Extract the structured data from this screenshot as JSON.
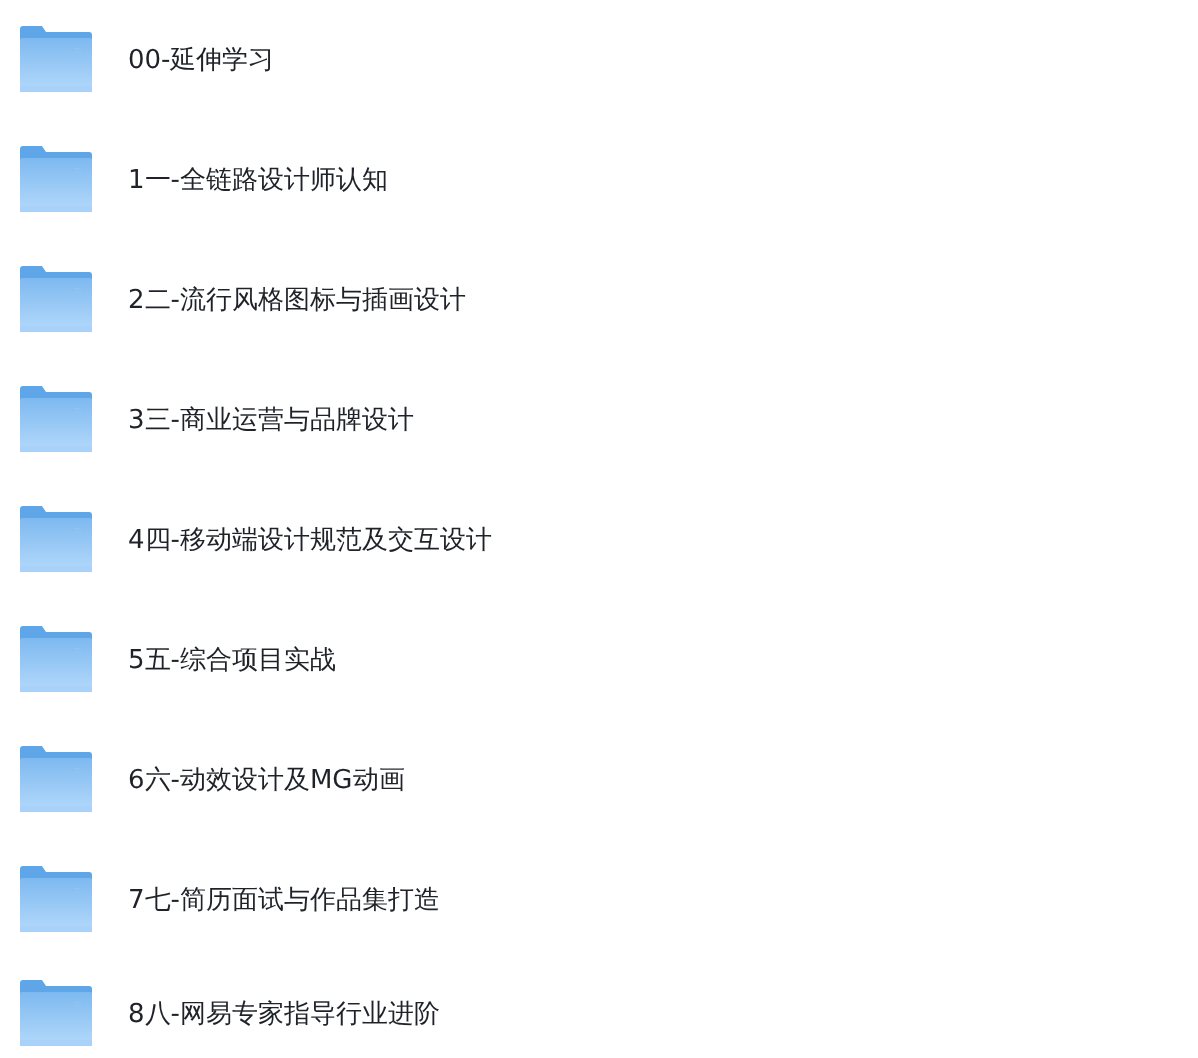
{
  "folders": [
    {
      "name": "00-延伸学习"
    },
    {
      "name": "1一-全链路设计师认知"
    },
    {
      "name": "2二-流行风格图标与插画设计"
    },
    {
      "name": "3三-商业运营与品牌设计"
    },
    {
      "name": "4四-移动端设计规范及交互设计"
    },
    {
      "name": "5五-综合项目实战"
    },
    {
      "name": "6六-动效设计及MG动画"
    },
    {
      "name": "7七-简历面试与作品集打造"
    },
    {
      "name": "8八-网易专家指导行业进阶"
    }
  ]
}
